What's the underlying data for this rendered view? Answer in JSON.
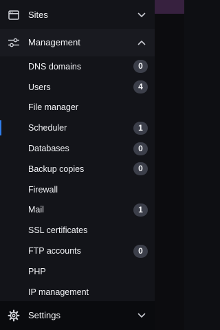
{
  "sidebar": {
    "sites": {
      "label": "Sites",
      "icon": "browser-window-icon",
      "expanded": false
    },
    "management": {
      "label": "Management",
      "icon": "sliders-icon",
      "expanded": true,
      "items": [
        {
          "label": "DNS domains",
          "badge": "0"
        },
        {
          "label": "Users",
          "badge": "4"
        },
        {
          "label": "File manager",
          "badge": ""
        },
        {
          "label": "Scheduler",
          "badge": "1",
          "active": true
        },
        {
          "label": "Databases",
          "badge": "0"
        },
        {
          "label": "Backup copies",
          "badge": "0"
        },
        {
          "label": "Firewall",
          "badge": ""
        },
        {
          "label": "Mail",
          "badge": "1"
        },
        {
          "label": "SSL certificates",
          "badge": ""
        },
        {
          "label": "FTP accounts",
          "badge": "0"
        },
        {
          "label": "PHP",
          "badge": ""
        },
        {
          "label": "IP management",
          "badge": ""
        }
      ]
    },
    "settings": {
      "label": "Settings",
      "icon": "gear-icon",
      "expanded": false
    }
  },
  "colors": {
    "sidebar_bg": "#131419",
    "active_indicator": "#2f7dea",
    "badge_bg": "#3c3f4a",
    "accent_strip": "#37213f"
  }
}
